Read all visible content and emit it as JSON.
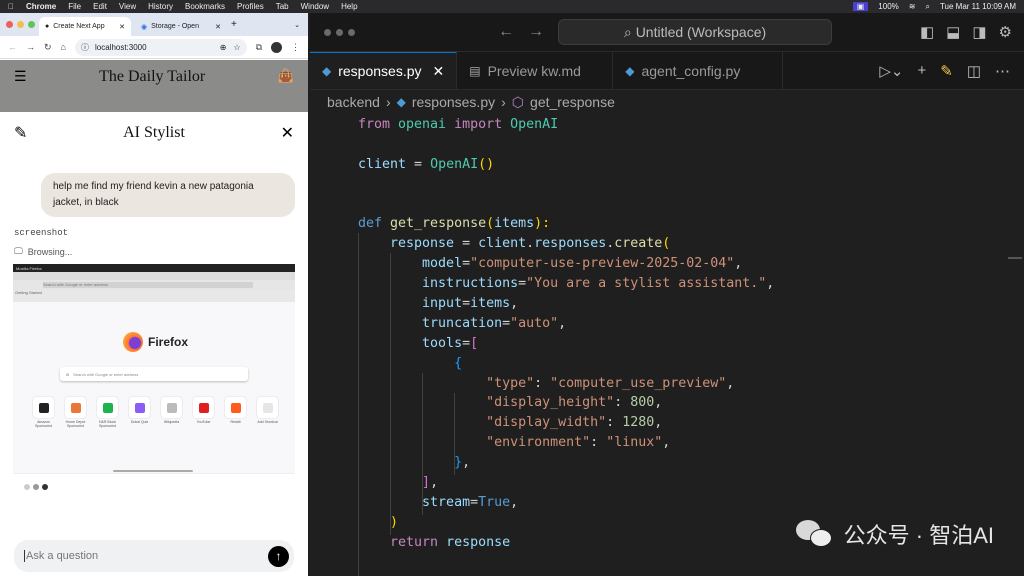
{
  "menubar": {
    "app": "Chrome",
    "items": [
      "File",
      "Edit",
      "View",
      "History",
      "Bookmarks",
      "Profiles",
      "Tab",
      "Window",
      "Help"
    ],
    "battery": "100%",
    "clock": "Tue Mar 11  10:09 AM"
  },
  "browser": {
    "tabs": [
      {
        "label": "Create Next App",
        "active": true
      },
      {
        "label": "Storage - OpenAI A",
        "active": false
      }
    ],
    "url": "localhost:3000"
  },
  "site": {
    "title": "The Daily Tailor"
  },
  "chat": {
    "title": "AI Stylist",
    "user_message": "help me find my friend kevin a new patagonia jacket, in black",
    "tool_name": "screenshot",
    "status": "Browsing...",
    "input_placeholder": "Ask a question",
    "screenshot": {
      "window_title": "Mozilla Firefox",
      "address_placeholder": "Search with Google or enter address",
      "bookmark": "Getting Started",
      "brand": "Firefox",
      "search_placeholder": "Search with Google or enter address",
      "tiles": [
        {
          "label": "Amazon",
          "sub": "Sponsored",
          "color": "#222222"
        },
        {
          "label": "Home Depot",
          "sub": "Sponsored",
          "color": "#e8773a"
        },
        {
          "label": "H&R Block",
          "sub": "Sponsored",
          "color": "#1fb34d"
        },
        {
          "label": "Dubai Quiz",
          "sub": "",
          "color": "#8b5cf6"
        },
        {
          "label": "Wikipedia",
          "sub": "",
          "color": "#bbbbbb"
        },
        {
          "label": "YouTube",
          "sub": "",
          "color": "#e02020"
        },
        {
          "label": "Reddit",
          "sub": "",
          "color": "#ff5a1f"
        },
        {
          "label": "Add Shortcut",
          "sub": "",
          "color": "#e6e6e6"
        }
      ]
    }
  },
  "editor": {
    "workspace": "Untitled (Workspace)",
    "tabs": [
      {
        "label": "responses.py",
        "icon": "python-icon",
        "active": true
      },
      {
        "label": "Preview kw.md",
        "icon": "preview-icon",
        "active": false
      },
      {
        "label": "agent_config.py",
        "icon": "python-icon",
        "active": false
      }
    ],
    "breadcrumbs": [
      "backend",
      "responses.py",
      "get_response"
    ],
    "code": [
      [
        [
          "from ",
          "kw"
        ],
        [
          "openai ",
          "mod"
        ],
        [
          "import ",
          "kw"
        ],
        [
          "OpenAI",
          "mod"
        ]
      ],
      [],
      [
        [
          "client",
          "var"
        ],
        [
          " = ",
          "op"
        ],
        [
          "OpenAI",
          "mod"
        ],
        [
          "()",
          "p1"
        ]
      ],
      [],
      [],
      [
        [
          "def ",
          "kd"
        ],
        [
          "get_response",
          "fn"
        ],
        [
          "(",
          "p1"
        ],
        [
          "items",
          "var"
        ],
        [
          "):",
          "p1"
        ]
      ],
      [
        [
          "    response",
          "var"
        ],
        [
          " = ",
          "op"
        ],
        [
          "client",
          "var"
        ],
        [
          ".",
          "op"
        ],
        [
          "responses",
          "var"
        ],
        [
          ".",
          "op"
        ],
        [
          "create",
          "fn"
        ],
        [
          "(",
          "p1"
        ]
      ],
      [
        [
          "        model",
          "var"
        ],
        [
          "=",
          "op"
        ],
        [
          "\"computer-use-preview-2025-02-04\"",
          "str"
        ],
        [
          ",",
          "op"
        ]
      ],
      [
        [
          "        instructions",
          "var"
        ],
        [
          "=",
          "op"
        ],
        [
          "\"You are a stylist assistant.\"",
          "str"
        ],
        [
          ",",
          "op"
        ]
      ],
      [
        [
          "        input",
          "var"
        ],
        [
          "=",
          "op"
        ],
        [
          "items",
          "var"
        ],
        [
          ",",
          "op"
        ]
      ],
      [
        [
          "        truncation",
          "var"
        ],
        [
          "=",
          "op"
        ],
        [
          "\"auto\"",
          "str"
        ],
        [
          ",",
          "op"
        ]
      ],
      [
        [
          "        tools",
          "var"
        ],
        [
          "=",
          "op"
        ],
        [
          "[",
          "p2"
        ]
      ],
      [
        [
          "            {",
          "p3"
        ]
      ],
      [
        [
          "                \"type\"",
          "str"
        ],
        [
          ": ",
          "op"
        ],
        [
          "\"computer_use_preview\"",
          "str"
        ],
        [
          ",",
          "op"
        ]
      ],
      [
        [
          "                \"display_height\"",
          "str"
        ],
        [
          ": ",
          "op"
        ],
        [
          "800",
          "num"
        ],
        [
          ",",
          "op"
        ]
      ],
      [
        [
          "                \"display_width\"",
          "str"
        ],
        [
          ": ",
          "op"
        ],
        [
          "1280",
          "num"
        ],
        [
          ",",
          "op"
        ]
      ],
      [
        [
          "                \"environment\"",
          "str"
        ],
        [
          ": ",
          "op"
        ],
        [
          "\"linux\"",
          "str"
        ],
        [
          ",",
          "op"
        ]
      ],
      [
        [
          "            }",
          "p3"
        ],
        [
          ",",
          "op"
        ]
      ],
      [
        [
          "        ]",
          "p2"
        ],
        [
          ",",
          "op"
        ]
      ],
      [
        [
          "        stream",
          "var"
        ],
        [
          "=",
          "op"
        ],
        [
          "True",
          "kd"
        ],
        [
          ",",
          "op"
        ]
      ],
      [
        [
          "    )",
          "p1"
        ]
      ],
      [
        [
          "    return ",
          "kw"
        ],
        [
          "response",
          "var"
        ]
      ]
    ]
  },
  "watermark": "公众号 · 智泊AI"
}
